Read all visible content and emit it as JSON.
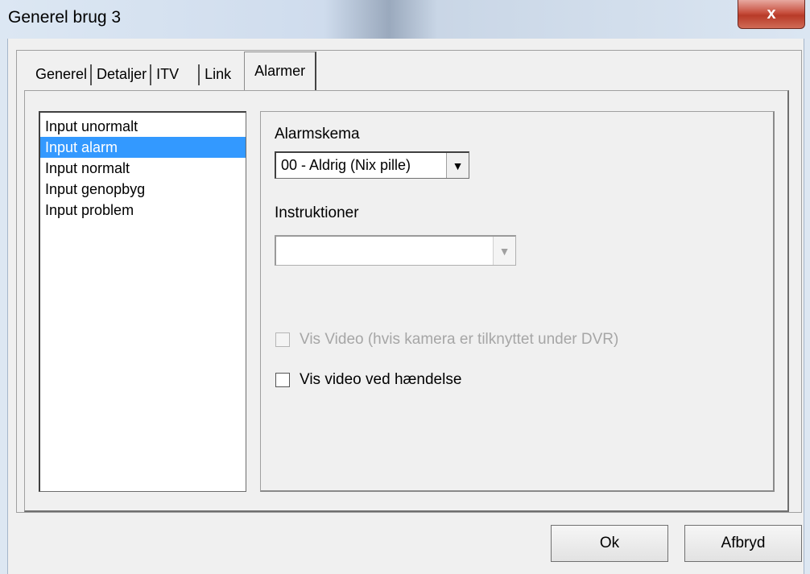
{
  "window": {
    "title": "Generel brug 3",
    "close_label": "x"
  },
  "tabs": [
    {
      "label": "Generel"
    },
    {
      "label": "Detaljer"
    },
    {
      "label": "ITV"
    },
    {
      "label": "Link"
    },
    {
      "label": "Alarmer",
      "active": true
    }
  ],
  "list": {
    "items": [
      {
        "label": "Input unormalt"
      },
      {
        "label": "Input alarm",
        "selected": true
      },
      {
        "label": "Input normalt"
      },
      {
        "label": "Input genopbyg"
      },
      {
        "label": "Input problem"
      }
    ]
  },
  "alarm": {
    "schedule_label": "Alarmskema",
    "schedule_value": "00 - Aldrig (Nix pille)",
    "instructions_label": "Instruktioner",
    "instructions_value": "",
    "vis_video_label": "Vis Video (hvis kamera er tilknyttet under DVR)",
    "vis_video_event_label": "Vis video ved hændelse"
  },
  "buttons": {
    "ok": "Ok",
    "cancel": "Afbryd"
  },
  "icons": {
    "dropdown": "chevron-down-icon",
    "close": "close-icon"
  },
  "colors": {
    "selection": "#3399ff",
    "close_button": "#c7503f"
  }
}
